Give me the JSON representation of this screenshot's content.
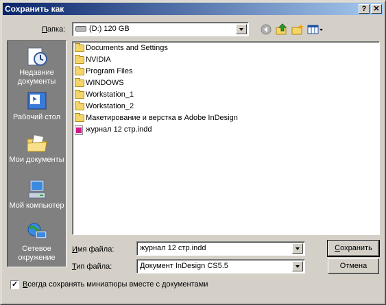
{
  "window": {
    "title": "Сохранить как",
    "help_button": "?",
    "close_button": "✕"
  },
  "lookin": {
    "label": "Папка:",
    "label_access": "П",
    "label_rest": "апка:",
    "value": "(D:) 120 GB"
  },
  "places": [
    {
      "label": "Недавние документы",
      "icon": "recent-documents-icon"
    },
    {
      "label": "Рабочий стол",
      "icon": "desktop-icon"
    },
    {
      "label": "Мои документы",
      "icon": "my-documents-icon"
    },
    {
      "label": "Мой компьютер",
      "icon": "my-computer-icon"
    },
    {
      "label": "Сетевое окружение",
      "icon": "network-places-icon"
    }
  ],
  "files": [
    {
      "name": "Documents and Settings",
      "type": "folder"
    },
    {
      "name": "NVIDIA",
      "type": "folder"
    },
    {
      "name": "Program Files",
      "type": "folder"
    },
    {
      "name": "WINDOWS",
      "type": "folder"
    },
    {
      "name": "Workstation_1",
      "type": "folder"
    },
    {
      "name": "Workstation_2",
      "type": "folder"
    },
    {
      "name": "Макетирование и верстка в Adobe InDesign",
      "type": "folder"
    },
    {
      "name": "журнал 12 стр.indd",
      "type": "indd"
    }
  ],
  "filename": {
    "label_access": "И",
    "label_rest": "мя файла:",
    "value": "журнал 12 стр.indd"
  },
  "filetype": {
    "label_access": "Т",
    "label_rest": "ип файла:",
    "value": "Документ InDesign CS5.5"
  },
  "buttons": {
    "save": "Сохранить",
    "save_access": "С",
    "save_rest": "охранить",
    "cancel": "Отмена"
  },
  "thumbnail_option": {
    "label": "Всегда сохранять миниатюры вместе с документами",
    "access": "В",
    "rest": "сегда сохранять миниатюры вместе с документами",
    "checked": true
  },
  "colors": {
    "title_start": "#0a246a",
    "title_end": "#a6caf0",
    "face": "#d4d0c8",
    "places_bar": "#808080"
  }
}
